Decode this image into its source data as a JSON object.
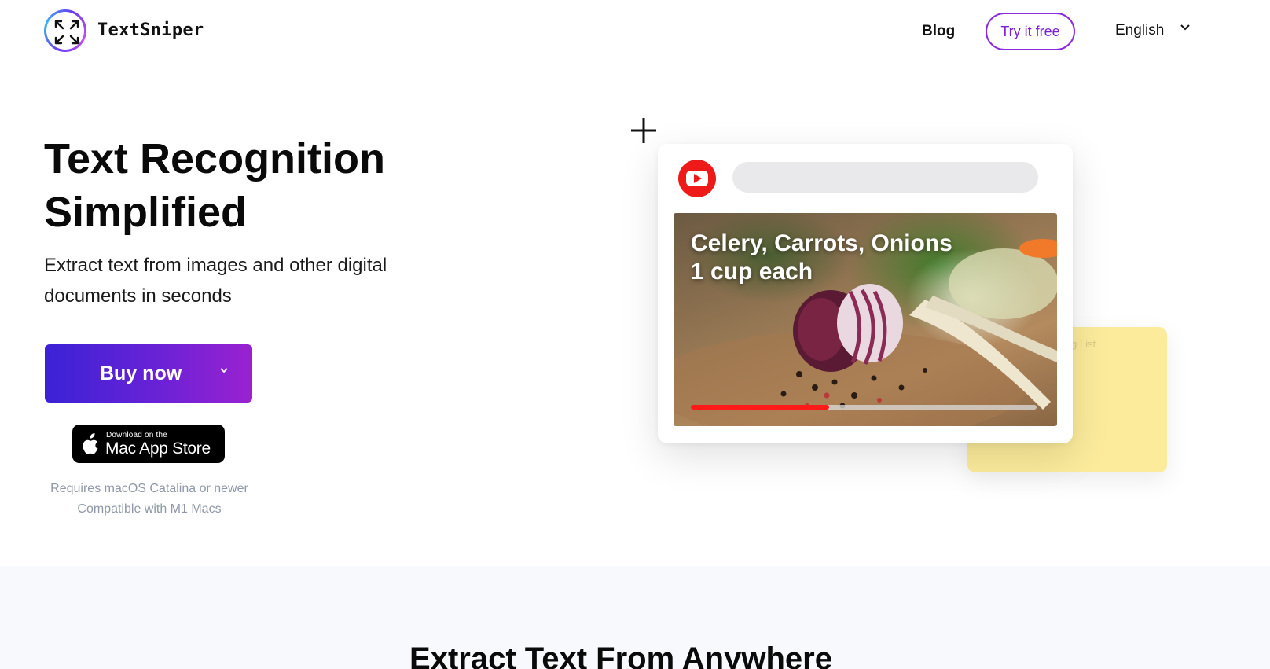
{
  "header": {
    "brand": "TextSniper",
    "nav": {
      "blog": "Blog",
      "try_free": "Try it free",
      "language": "English"
    }
  },
  "hero": {
    "title_line1": "Text Recognition",
    "title_line2": "Simplified",
    "subtitle_line1": "Extract text from images and other digital",
    "subtitle_line2": "documents in seconds",
    "buy_button": "Buy now",
    "appstore": {
      "small": "Download on the",
      "big": "Mac App Store"
    },
    "requirements": "Requires macOS Catalina or newer",
    "compatibility": "Compatible with M1 Macs"
  },
  "illustration": {
    "video_caption_line1": "Celery, Carrots, Onions",
    "video_caption_line2": "1 cup each",
    "video_progress": 0.4,
    "sticky_note_label": "g List",
    "accent_red": "#ff1a1a",
    "sticky_color": "#fbeb9b"
  },
  "features": {
    "title": "Extract Text From Anywhere"
  },
  "colors": {
    "brand_purple": "#8a2be2",
    "buy_gradient_start": "#3b22d6",
    "buy_gradient_end": "#9a22d0"
  }
}
